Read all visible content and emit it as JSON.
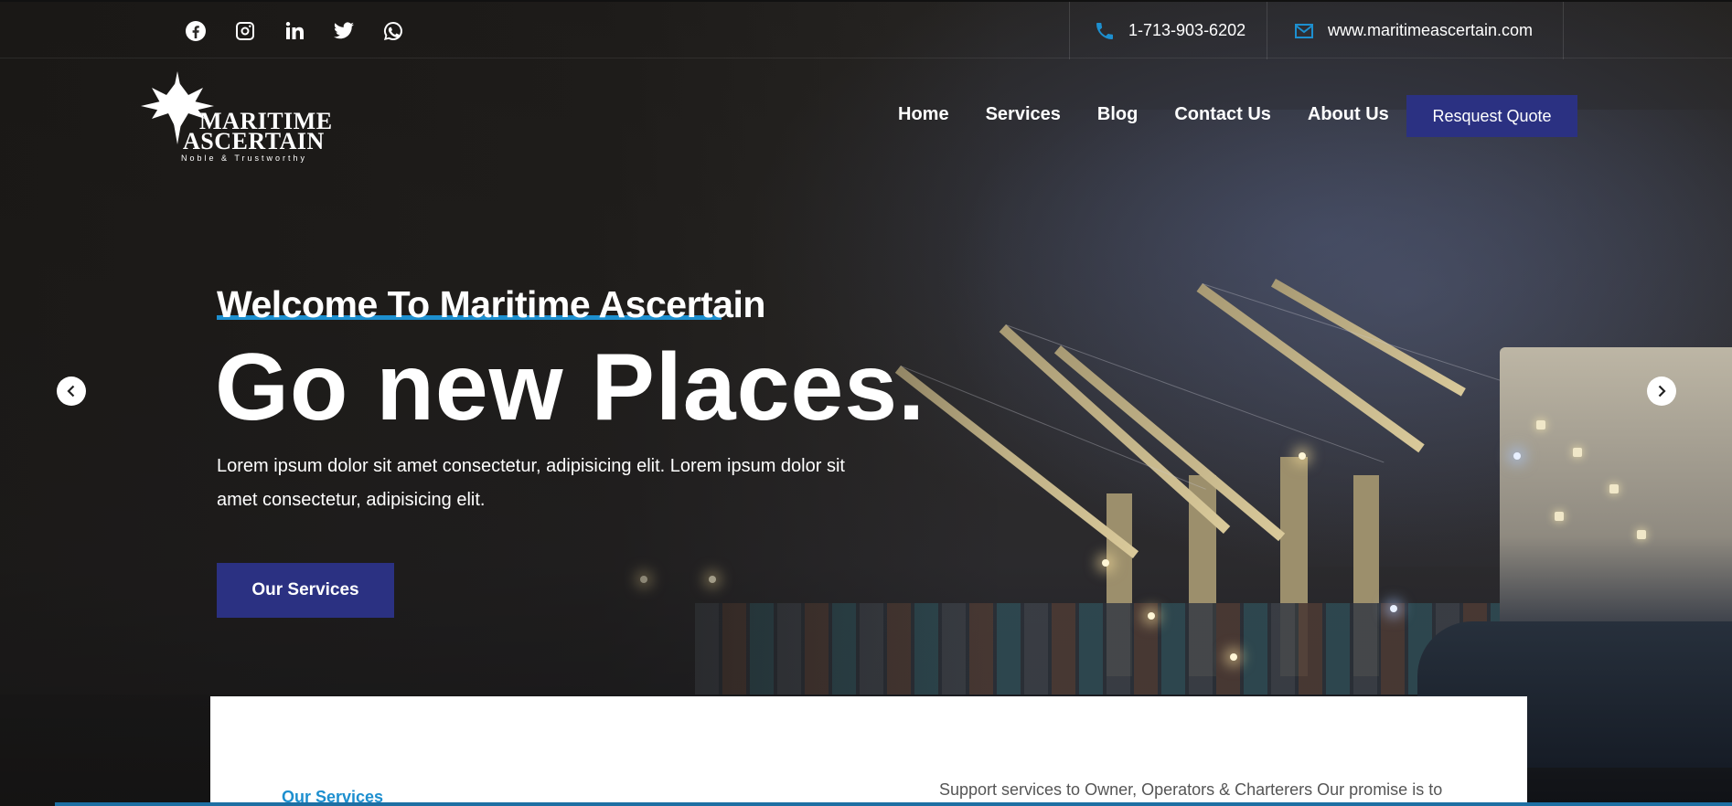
{
  "topbar": {
    "socials": [
      {
        "icon": "facebook-icon"
      },
      {
        "icon": "instagram-icon"
      },
      {
        "icon": "linkedin-icon"
      },
      {
        "icon": "twitter-icon"
      },
      {
        "icon": "whatsapp-icon"
      }
    ],
    "phone": "1-713-903-6202",
    "website": "www.maritimeascertain.com"
  },
  "logo": {
    "line1": "MARITIME",
    "line2": "ASCERTAIN",
    "tagline": "Noble & Trustworthy"
  },
  "nav": {
    "items": [
      "Home",
      "Services",
      "Blog",
      "Contact Us",
      "About Us"
    ],
    "quote_button": "Resquest Quote"
  },
  "hero": {
    "welcome": "Welcome To Maritime Ascertain",
    "headline": "Go new Places.",
    "lead": "Lorem ipsum dolor sit amet consectetur, adipisicing elit. Lorem ipsum dolor sit amet consectetur, adipisicing elit.",
    "cta": "Our Services"
  },
  "panel": {
    "label": "Our Services",
    "text": "Support services to Owner, Operators & Charterers Our promise is to"
  },
  "colors": {
    "accent_blue": "#1d8fcf",
    "button_navy": "#2b3182"
  }
}
